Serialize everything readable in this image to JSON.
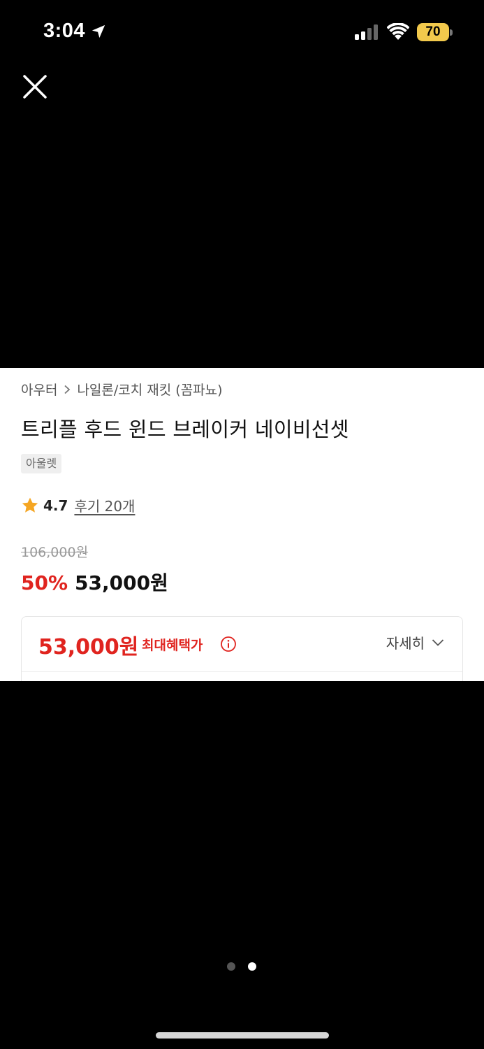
{
  "status_bar": {
    "time": "3:04",
    "battery": "70",
    "battery_color": "#f2c94c"
  },
  "close_icon": "close-icon",
  "product": {
    "breadcrumb": [
      "아우터",
      "나일론/코치 재킷 (꼼파뇨)"
    ],
    "title": "트리플 후드 윈드 브레이커 네이비선셋",
    "tag": "아울렛",
    "rating": "4.7",
    "review_link": "후기 20개",
    "original_price": "106,000원",
    "discount": "50%",
    "sale_price": "53,000원"
  },
  "benefit": {
    "price": "53,000원",
    "label": "최대혜택가",
    "detail_label": "자세히"
  },
  "pager": {
    "total": 2,
    "active_index": 1
  },
  "colors": {
    "accent_red": "#e0241f",
    "star": "#f5a623"
  }
}
